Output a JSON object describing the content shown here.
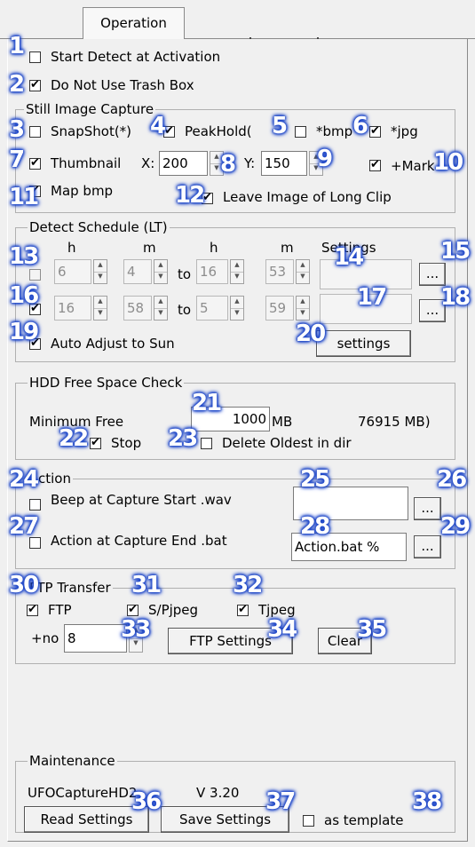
{
  "tab": {
    "label": "Operation"
  },
  "general": {
    "start_detect": "Start Detect at Activation",
    "no_trash": "Do Not Use Trash Box"
  },
  "still": {
    "title": "Still Image Capture",
    "snapshot": "SnapShot(*)",
    "peakhold": "PeakHold(",
    "bmp": "*bmp",
    "jpg": "*jpg",
    "thumbnail": "Thumbnail",
    "x_label": "X:",
    "x_value": "200",
    "y_label": "Y:",
    "y_value": "150",
    "mark": "+Mark",
    "map_bmp": "Map bmp",
    "leave_long": "Leave Image of Long Clip"
  },
  "schedule": {
    "title": "Detect Schedule (LT)",
    "h1": "h",
    "m1": "m",
    "h2": "h",
    "m2": "m",
    "settings_header": "Settings",
    "to": "to",
    "row1": {
      "h1": "6",
      "m1": "4",
      "h2": "16",
      "m2": "53"
    },
    "row2": {
      "h1": "16",
      "m1": "58",
      "h2": "5",
      "m2": "59"
    },
    "browse": "...",
    "auto_sun": "Auto Adjust to Sun",
    "settings_btn": "settings"
  },
  "hdd": {
    "title": "HDD Free Space Check",
    "min_free": "Minimum Free",
    "min_value": "1000",
    "unit": "MB",
    "free_total": "76915 MB)",
    "stop": "Stop",
    "delete_oldest": "Delete Oldest in dir"
  },
  "action": {
    "title": "Action",
    "beep": "Beep at Capture Start .wav",
    "beep_value": "",
    "end": "Action at Capture End .bat",
    "end_value": "Action.bat %",
    "browse": "..."
  },
  "ftp": {
    "title": "FTP Transfer",
    "ftp": "FTP",
    "spjpeg": "S/Pjpeg",
    "tjpeg": "Tjpeg",
    "no_label": "+no",
    "no_value": "8",
    "settings_btn": "FTP Settings",
    "clear_btn": "Clear"
  },
  "maintenance": {
    "title": "Maintenance",
    "app": "UFOCaptureHD2",
    "version": "V 3.20",
    "read_btn": "Read Settings",
    "save_btn": "Save Settings",
    "as_template": "as template"
  },
  "badges": [
    "1",
    "2",
    "3",
    "4",
    "5",
    "6",
    "7",
    "8",
    "9",
    "10",
    "11",
    "12",
    "13",
    "14",
    "15",
    "16",
    "17",
    "18",
    "19",
    "20",
    "21",
    "22",
    "23",
    "24",
    "25",
    "26",
    "27",
    "28",
    "29",
    "30",
    "31",
    "32",
    "33",
    "34",
    "35",
    "36",
    "37",
    "38"
  ],
  "colors": {
    "badge": "#1e47c8",
    "panel": "#f0f0f0"
  }
}
